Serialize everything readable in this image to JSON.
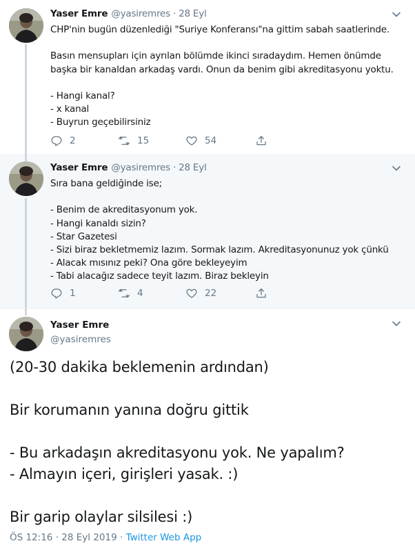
{
  "tweets": [
    {
      "name": "Yaser Emre",
      "handle": "@yasiremres",
      "separator": "·",
      "date": "28 Eyl",
      "lines": [
        "CHP'nin bugün düzenlediği \"Suriye Konferansı\"na gittim sabah saatlerinde.",
        "",
        "Basın mensupları için ayrılan bölümde ikinci sıradaydım. Hemen önümde",
        "başka bir kanaldan arkadaş vardı. Onun da benim gibi akreditasyonu yoktu.",
        "",
        "- Hangi kanal?",
        "- x kanal",
        "- Buyrun geçebilirsiniz"
      ],
      "replies": "2",
      "retweets": "15",
      "likes": "54"
    },
    {
      "name": "Yaser Emre",
      "handle": "@yasiremres",
      "separator": "·",
      "date": "28 Eyl",
      "lines": [
        "Sıra bana geldiğinde ise;",
        "",
        "- Benim de akreditasyonum yok.",
        "- Hangi kanaldı sizin?",
        "- Star Gazetesi",
        "- Sizi biraz  bekletmemiz lazım. Sormak lazım. Akreditasyonunuz yok çünkü",
        "- Alacak mısınız peki? Ona göre bekleyeyim",
        "- Tabi alacağız sadece teyit lazım. Biraz bekleyin"
      ],
      "replies": "1",
      "retweets": "4",
      "likes": "22"
    }
  ],
  "focused": {
    "name": "Yaser Emre",
    "handle": "@yasiremres",
    "lines": [
      "(20-30 dakika beklemenin ardından)",
      "",
      "Bir korumanın yanına doğru gittik",
      "",
      "- Bu arkadaşın akreditasyonu yok. Ne yapalım?",
      "- Almayın içeri, girişleri yasak. :)",
      "",
      "Bir garip olaylar silsilesi :)"
    ],
    "time": "ÖS 12:16",
    "separator": "·",
    "full_date": "28 Eyl 2019",
    "source": "Twitter Web App"
  },
  "colors": {
    "text": "#14171a",
    "secondary": "#657786",
    "link": "#1b95e0",
    "thread_line": "#ccd6dd",
    "highlight_bg": "#f5f8fa"
  },
  "icons": [
    "avatar",
    "chevron-down-icon",
    "reply-icon",
    "retweet-icon",
    "like-icon",
    "share-icon"
  ]
}
